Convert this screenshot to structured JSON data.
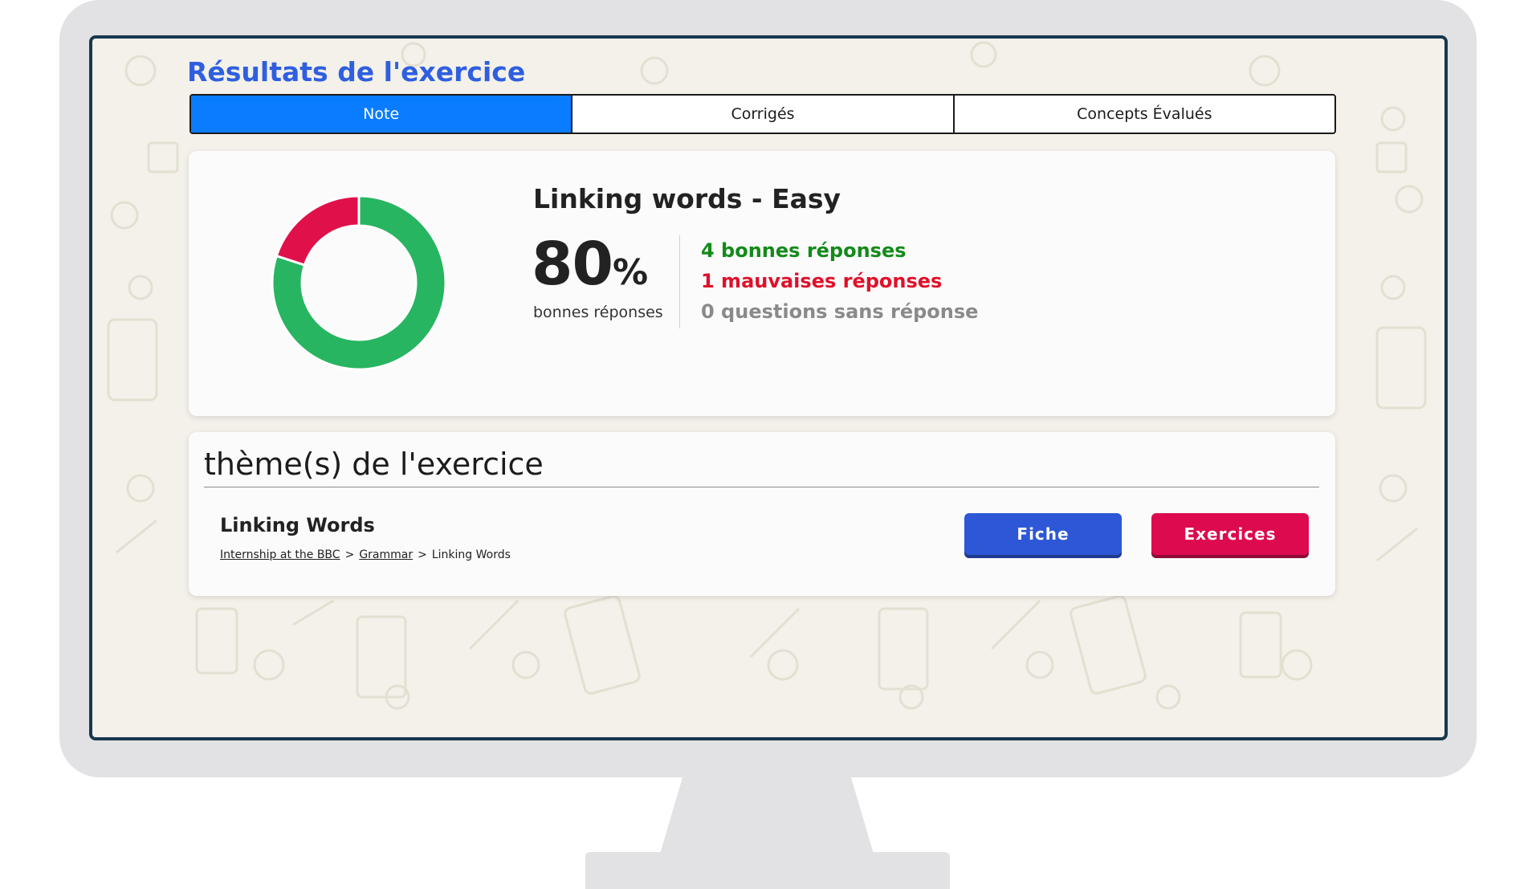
{
  "page": {
    "title": "Résultats de l'exercice"
  },
  "tabs": [
    {
      "label": "Note",
      "active": true
    },
    {
      "label": "Corrigés",
      "active": false
    },
    {
      "label": "Concepts Évalués",
      "active": false
    }
  ],
  "score": {
    "exercise_name": "Linking words - Easy",
    "percent_value": "80",
    "percent_sign": "%",
    "caption": "bonnes réponses",
    "correct": 4,
    "incorrect": 1,
    "unanswered": 0,
    "correct_text": "4 bonnes réponses",
    "incorrect_text": "1 mauvaises réponses",
    "unanswered_text": "0 questions sans réponse",
    "colors": {
      "correct": "#27b561",
      "incorrect": "#e0104a",
      "good_text": "#138a1a",
      "bad_text": "#e0102a",
      "none_text": "#8a8a8a"
    }
  },
  "theme": {
    "heading": "thème(s) de l'exercice",
    "title": "Linking Words",
    "breadcrumb": [
      {
        "label": "Internship at the BBC",
        "link": true
      },
      {
        "label": "Grammar",
        "link": true
      },
      {
        "label": "Linking Words",
        "link": false
      }
    ],
    "separator": ">",
    "buttons": {
      "fiche": "Fiche",
      "exercices": "Exercices"
    }
  },
  "colors": {
    "accent": "#0a7cff",
    "title": "#2f5fe0",
    "screen_bg": "#f3f1e9",
    "fiche_button": "#2d57d6",
    "exercices_button": "#dd0a4f"
  }
}
